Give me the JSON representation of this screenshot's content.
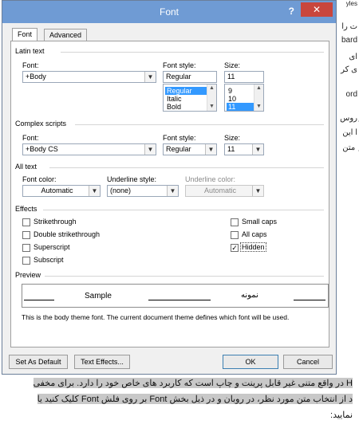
{
  "window": {
    "title": "Font",
    "help_icon": "?",
    "close_icon": "✕"
  },
  "tabs": [
    {
      "label": "Font",
      "active": true
    },
    {
      "label": "Advanced",
      "active": false
    }
  ],
  "latin": {
    "section": "Latin text",
    "font_label": "Font:",
    "font_value": "+Body",
    "style_label": "Font style:",
    "style_value": "Regular",
    "style_options": [
      "Regular",
      "Italic",
      "Bold"
    ],
    "size_label": "Size:",
    "size_value": "11",
    "size_options": [
      "9",
      "10",
      "11"
    ]
  },
  "complex": {
    "section": "Complex scripts",
    "font_label": "Font:",
    "font_value": "+Body CS",
    "style_label": "Font style:",
    "style_value": "Regular",
    "size_label": "Size:",
    "size_value": "11"
  },
  "alltext": {
    "section": "All text",
    "color_label": "Font color:",
    "color_value": "Automatic",
    "underline_label": "Underline style:",
    "underline_value": "(none)",
    "underline_color_label": "Underline color:",
    "underline_color_value": "Automatic"
  },
  "effects": {
    "section": "Effects",
    "strikethrough": "Strikethrough",
    "double_strikethrough": "Double strikethrough",
    "superscript": "Superscript",
    "subscript": "Subscript",
    "small_caps": "Small caps",
    "all_caps": "All caps",
    "hidden": "Hidden",
    "hidden_checked": true,
    "check_mark": "✓"
  },
  "preview": {
    "section": "Preview",
    "sample": "Sample",
    "sample_fa": "نمونه",
    "note": "This is the body theme font. The current document theme defines which font will be used."
  },
  "buttons": {
    "set_default": "Set As Default",
    "text_effects": "Text Effects...",
    "ok": "OK",
    "cancel": "Cancel"
  },
  "background": {
    "right_lines": [
      "ت را",
      "bard",
      "ای",
      "ی کر",
      "ord",
      "ِروس",
      "ا این",
      "ِ متن"
    ],
    "top_fragment": "yles",
    "banner_line1": "H در واقع متنی غیر قابل پرینت و چاپ است که کاربرد های خاص خود را دارد. برای مخفی",
    "banner_line2": "د از انتخاب متن مورد نظر، در روبان و در ذیل بخش Font بر روی فلش Font کلیک کنید یا",
    "banner_line3": "نمایید:"
  }
}
